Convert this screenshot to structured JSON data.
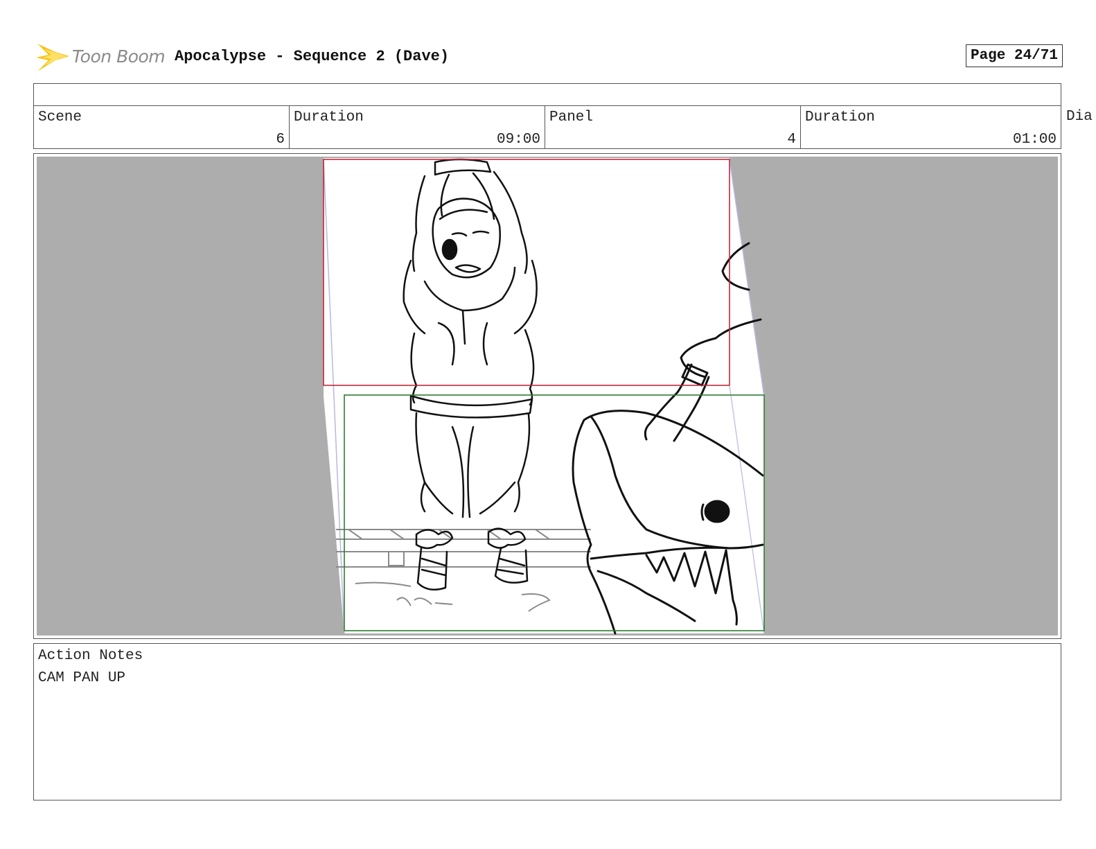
{
  "header": {
    "logo_text": "Toon Boom",
    "title": "Apocalypse - Sequence 2 (Dave)",
    "page": "Page 24/71"
  },
  "info": {
    "scene": {
      "label": "Scene",
      "value": "6"
    },
    "scene_duration": {
      "label": "Duration",
      "value": "09:00"
    },
    "panel": {
      "label": "Panel",
      "value": "4"
    },
    "panel_duration": {
      "label": "Duration",
      "value": "01:00"
    },
    "dialogue_label": "Dia"
  },
  "colors": {
    "canvas_gray": "#adadad",
    "camera_start": "#c0283a",
    "camera_end": "#2e7d32",
    "camera_path": "#b8b8e0",
    "logo_yellow": "#f5c518"
  },
  "notes": {
    "label": "Action Notes",
    "text": "CAM PAN UP"
  }
}
